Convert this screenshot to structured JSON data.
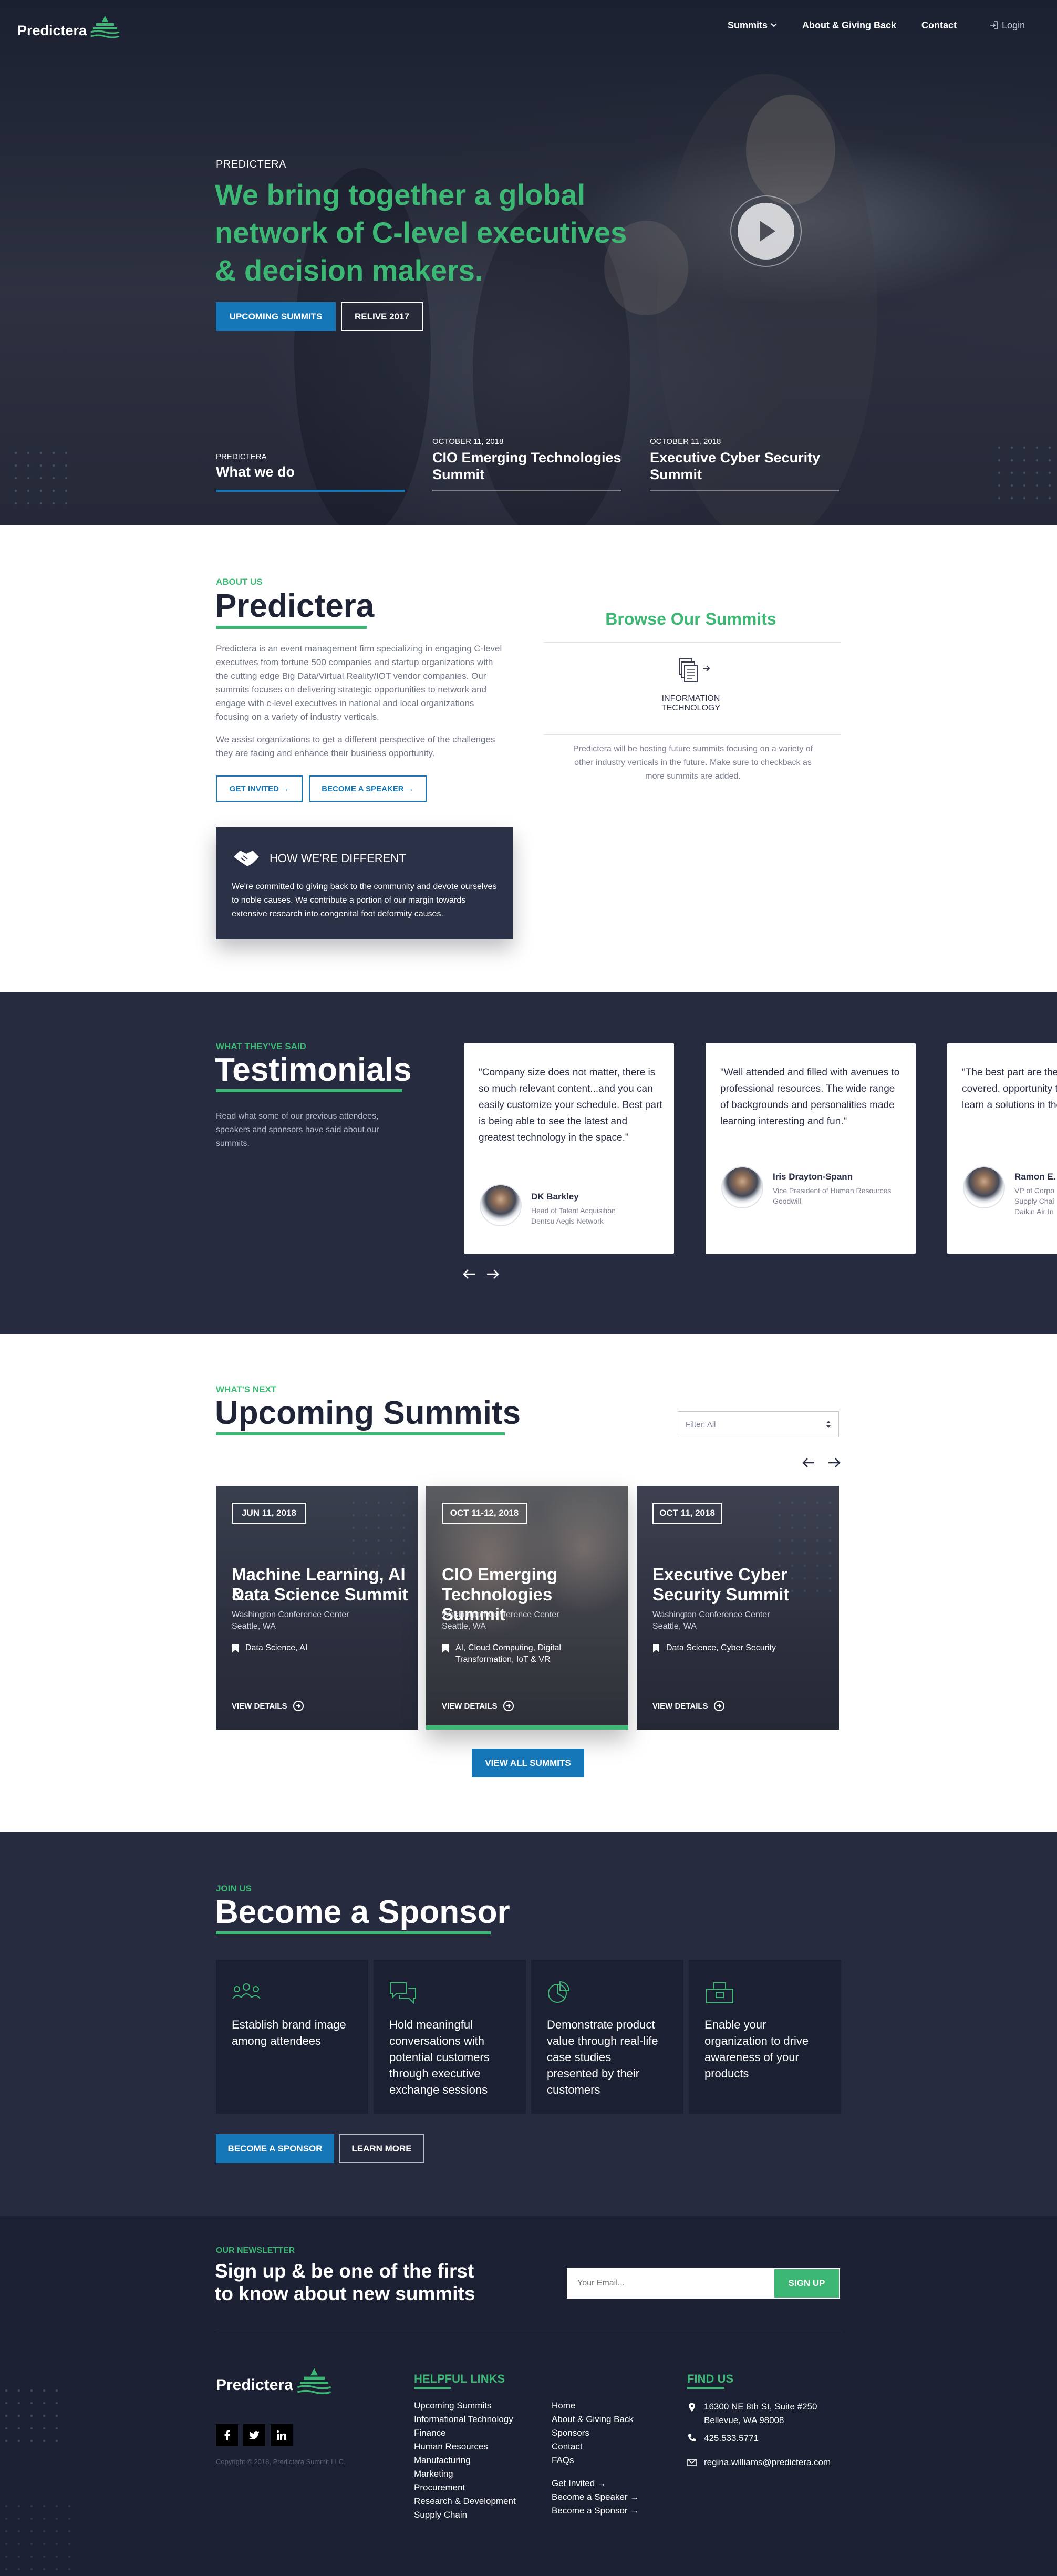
{
  "brand": {
    "name": "Predictera"
  },
  "nav": {
    "summits": "Summits",
    "about": "About & Giving Back",
    "contact": "Contact",
    "login": "Login"
  },
  "hero": {
    "eyebrow": "PREDICTERA",
    "headline_1": "We bring together a global",
    "headline_2": "network of C-level executives",
    "headline_3": "& decision makers.",
    "btn_upcoming": "UPCOMING SUMMITS",
    "btn_relive": "RELIVE 2017",
    "tabs": [
      {
        "small": "PREDICTERA",
        "title_1": "What we do",
        "title_2": ""
      },
      {
        "small": "OCTOBER 11, 2018",
        "title_1": "CIO Emerging Technologies",
        "title_2": "Summit"
      },
      {
        "small": "OCTOBER 11, 2018",
        "title_1": "Executive Cyber Security",
        "title_2": "Summit"
      }
    ]
  },
  "about": {
    "eyebrow": "ABOUT US",
    "title": "Predictera",
    "p1": "Predictera is an event management firm specializing in engaging C-level executives from fortune 500 companies and startup organizations with the cutting edge Big Data/Virtual Reality/IOT vendor companies. Our summits focuses on delivering strategic opportunities to network and engage with c-level executives in national and local organizations focusing on a variety of industry verticals.",
    "p2": "We assist organizations to get a different perspective of the challenges they are facing and enhance their business opportunity.",
    "btn_invited": "GET INVITED →",
    "btn_speaker": "BECOME A SPEAKER →",
    "browse_title": "Browse Our Summits",
    "category_1": "INFORMATION",
    "category_2": "TECHNOLOGY",
    "browse_note": "Predictera will be hosting future summits focusing on a variety of other industry verticals in the future. Make sure to checkback as more summits are added.",
    "diff_title": "HOW WE'RE DIFFERENT",
    "diff_text": "We're committed to giving back to the community and devote ourselves to noble causes. We contribute a portion of our margin towards extensive research into congenital foot deformity causes."
  },
  "testimonials": {
    "eyebrow": "WHAT THEY'VE SAID",
    "title": "Testimonials",
    "intro": "Read what some of our previous attendees, speakers and sponsors have said about our summits.",
    "items": [
      {
        "quote": "\"Company size does not matter, there is so much relevant content...and you can easily customize your schedule. Best part is being able to see the latest and greatest technology in the space.\"",
        "name": "DK Barkley",
        "role_1": "Head of Talent Acquisition",
        "role_2": "Dentsu Aegis Network",
        "role_3": ""
      },
      {
        "quote": "\"Well attended and filled with avenues to professional resources. The wide range of backgrounds and personalities made learning interesting and fun.\"",
        "name": "Iris Drayton-Spann",
        "role_1": "Vice President of Human Resources",
        "role_2": "Goodwill",
        "role_3": ""
      },
      {
        "quote": "\"The best part are the and topics covered. opportunity to hear network and learn a solutions in the field",
        "name": "Ramon E.",
        "role_1": "VP of Corpo",
        "role_2": "Supply Chai",
        "role_3": "Daikin Air In"
      }
    ]
  },
  "upcoming": {
    "eyebrow": "WHAT'S NEXT",
    "title": "Upcoming Summits",
    "filter": "Filter: All",
    "view_all": "VIEW ALL SUMMITS",
    "cards": [
      {
        "date": "JUN 11, 2018",
        "title_1": "Machine Learning, AI &",
        "title_2": "Data Science Summit",
        "loc_1": "Washington Conference Center",
        "loc_2": "Seattle, WA",
        "tags_1": "Data Science, AI",
        "tags_2": "",
        "details": "VIEW DETAILS"
      },
      {
        "date": "OCT 11-12, 2018",
        "title_1": "CIO Emerging",
        "title_2": "Technologies Summit",
        "loc_1": "Washington Conference Center",
        "loc_2": "Seattle, WA",
        "tags_1": "AI, Cloud Computing, Digital",
        "tags_2": "Transformation, IoT & VR",
        "details": "VIEW DETAILS"
      },
      {
        "date": "OCT 11, 2018",
        "title_1": "Executive Cyber",
        "title_2": "Security Summit",
        "loc_1": "Washington Conference Center",
        "loc_2": "Seattle, WA",
        "tags_1": "Data Science, Cyber Security",
        "tags_2": "",
        "details": "VIEW DETAILS"
      }
    ]
  },
  "sponsor": {
    "eyebrow": "JOIN US",
    "title": "Become a Sponsor",
    "cards": [
      {
        "l1": "Establish brand image",
        "l2": "among attendees",
        "l3": "",
        "l4": "",
        "l5": ""
      },
      {
        "l1": "Hold meaningful",
        "l2": "conversations with",
        "l3": "potential customers",
        "l4": "through executive",
        "l5": "exchange sessions"
      },
      {
        "l1": "Demonstrate product",
        "l2": "value through real-life",
        "l3": "case studies",
        "l4": "presented by their",
        "l5": "customers"
      },
      {
        "l1": "Enable your",
        "l2": "organization to drive",
        "l3": "awareness of your",
        "l4": "products",
        "l5": ""
      }
    ],
    "btn_sponsor": "BECOME A SPONSOR",
    "btn_learn": "LEARN MORE"
  },
  "newsletter": {
    "eyebrow": "OUR NEWSLETTER",
    "title_1": "Sign up & be one of the first",
    "title_2": "to know about new summits",
    "placeholder": "Your Email...",
    "btn": "SIGN UP"
  },
  "footer": {
    "copyright": "Copyright © 2018, Predictera Summit LLC.",
    "helpful_title": "HELPFUL LINKS",
    "col1": [
      "Upcoming Summits",
      "Informational Technology",
      "Finance",
      "Human Resources",
      "Manufacturing",
      "Marketing",
      "Procurement",
      "Research & Development",
      "Supply Chain"
    ],
    "col2": [
      "Home",
      "About & Giving Back",
      "Sponsors",
      "Contact",
      "FAQs"
    ],
    "col2_arrows": [
      "Get Invited →",
      "Become a Speaker →",
      "Become a Sponsor →"
    ],
    "find_title": "FIND US",
    "addr_1": "16300 NE 8th St, Suite #250",
    "addr_2": "Bellevue, WA 98008",
    "phone": "425.533.5771",
    "email": "regina.williams@predictera.com"
  },
  "colors": {
    "green": "#3db874",
    "blue": "#1677b8",
    "navy": "#262b40",
    "navy_dark": "#1b2133"
  }
}
